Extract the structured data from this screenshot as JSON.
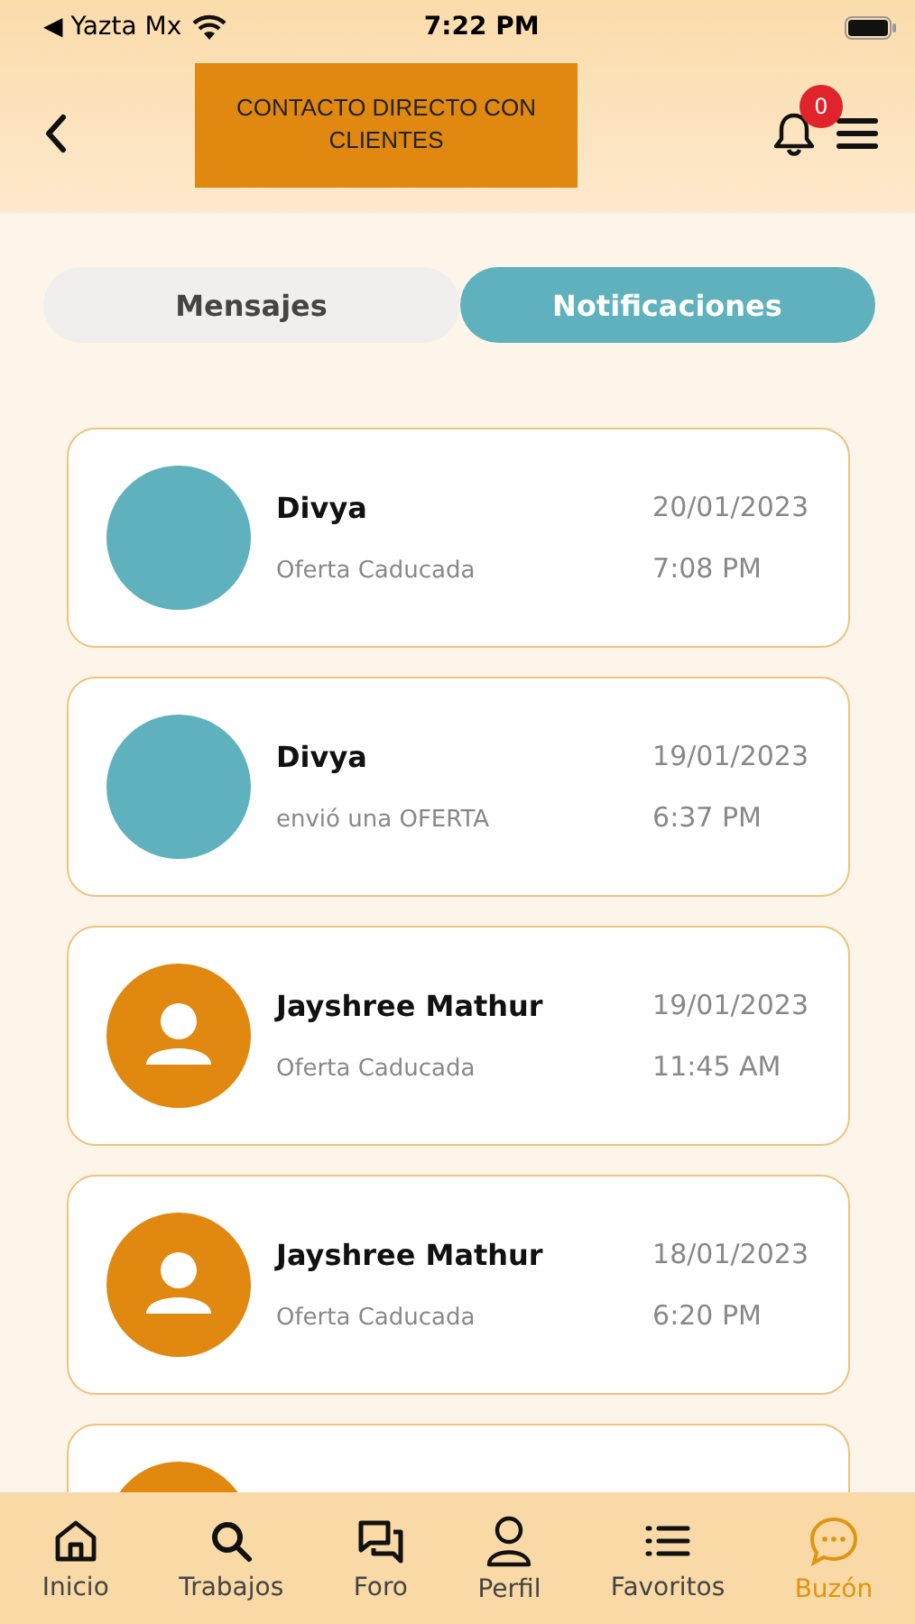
{
  "status_bar": {
    "carrier": "◀ Yazta Mx",
    "time": "7:22 PM"
  },
  "header": {
    "title": "CONTACTO DIRECTO CON CLIENTES",
    "notification_count": "0"
  },
  "tabs": [
    {
      "label": "Mensajes",
      "selected": false
    },
    {
      "label": "Notificaciones",
      "selected": true
    }
  ],
  "notifications": [
    {
      "kind": "blank",
      "name": "Divya",
      "message": "Oferta Caducada",
      "date": "20/01/2023",
      "time": "7:08 PM"
    },
    {
      "kind": "blank",
      "name": "Divya",
      "message": "envió una OFERTA",
      "date": "19/01/2023",
      "time": "6:37 PM"
    },
    {
      "kind": "person",
      "name": "Jayshree Mathur",
      "message": "Oferta Caducada",
      "date": "19/01/2023",
      "time": "11:45 AM"
    },
    {
      "kind": "person",
      "name": "Jayshree Mathur",
      "message": "Oferta Caducada",
      "date": "18/01/2023",
      "time": "6:20 PM"
    },
    {
      "kind": "person"
    }
  ],
  "bottom_nav": [
    {
      "label": "Inicio",
      "selected": false
    },
    {
      "label": "Trabajos",
      "selected": false
    },
    {
      "label": "Foro",
      "selected": false
    },
    {
      "label": "Perfil",
      "selected": false
    },
    {
      "label": "Favoritos",
      "selected": false
    },
    {
      "label": "Buzón",
      "selected": true
    }
  ]
}
